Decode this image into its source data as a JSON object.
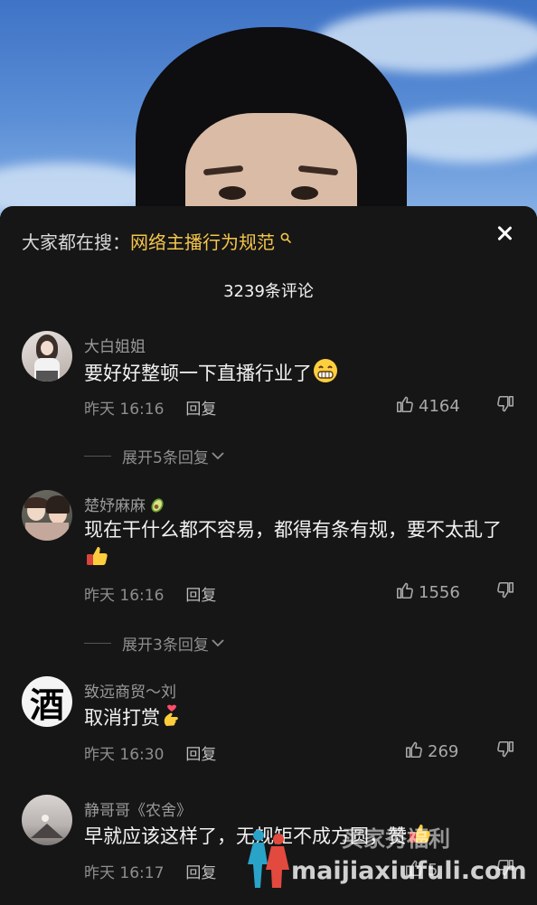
{
  "search_bar": {
    "prefix": "大家都在搜：",
    "term": "网络主播行为规范"
  },
  "comment_count": "3239条评论",
  "comments": [
    {
      "user": "大白姐姐",
      "text": "要好好整顿一下直播行业了",
      "time": "昨天 16:16",
      "reply": "回复",
      "likes": "4164",
      "expand": "展开5条回复"
    },
    {
      "user": "楚妤麻麻",
      "text": "现在干什么都不容易，都得有条有规，要不太乱了",
      "time": "昨天 16:16",
      "reply": "回复",
      "likes": "1556",
      "expand": "展开3条回复"
    },
    {
      "user": "致远商贸～刘",
      "text": "取消打赏",
      "time": "昨天 16:30",
      "reply": "回复",
      "likes": "269",
      "avatar_text": "酒"
    },
    {
      "user": "静哥哥《农舍》",
      "text": "早就应该这样了，无规矩不成方圆，赞",
      "time": "昨天 16:17",
      "reply": "回复",
      "likes": "5"
    }
  ],
  "watermark": {
    "line1": "买家秀福利",
    "line2": "maijiaxiufuli.com"
  },
  "icons": [
    "search-icon",
    "close-icon",
    "thumbs-up-icon",
    "thumbs-down-icon",
    "chevron-down-icon"
  ],
  "colors": {
    "background": "#161616",
    "accent": "#f4c54a"
  }
}
